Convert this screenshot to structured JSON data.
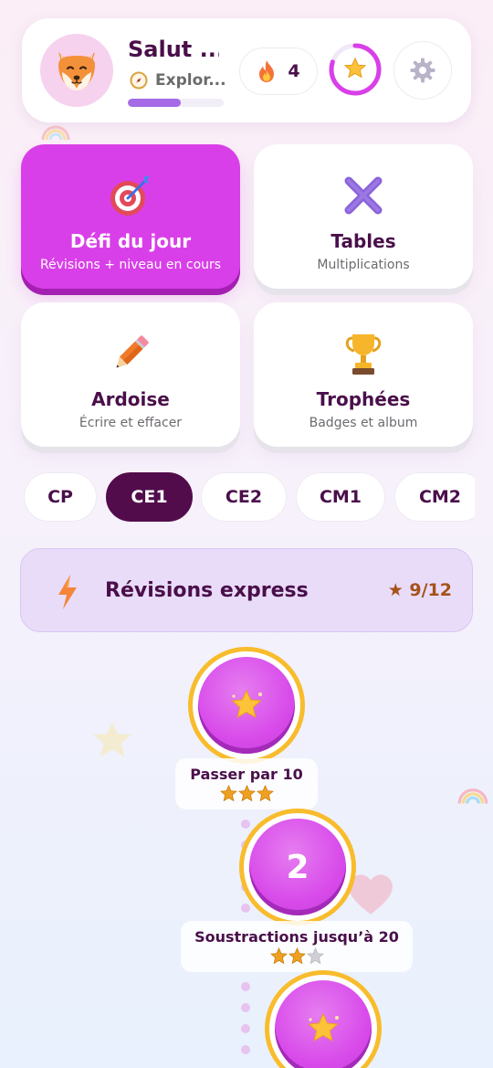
{
  "header": {
    "greeting": "Salut ...",
    "rank": "Explor...",
    "xp_progress": 0.55,
    "streak_count": "4",
    "star_progress": 0.8
  },
  "tiles": [
    {
      "title": "Défi du jour",
      "subtitle": "Révisions + niveau en cours",
      "icon": "target-icon"
    },
    {
      "title": "Tables",
      "subtitle": "Multiplications",
      "icon": "multiply-icon"
    },
    {
      "title": "Ardoise",
      "subtitle": "Écrire et effacer",
      "icon": "pencil-icon"
    },
    {
      "title": "Trophées",
      "subtitle": "Badges et album",
      "icon": "trophy-icon"
    }
  ],
  "grades": {
    "items": [
      "CP",
      "CE1",
      "CE2",
      "CM1",
      "CM2"
    ],
    "selected": "CE1"
  },
  "section": {
    "title": "Révisions express",
    "score": "★ 9/12"
  },
  "lessons": [
    {
      "badge": "star",
      "label": "Passer par 10",
      "stars": 3
    },
    {
      "badge": "2",
      "label": "Soustractions jusqu’à 20",
      "stars": 2
    },
    {
      "badge": "star",
      "label": "",
      "stars": 0
    }
  ],
  "colors": {
    "accent": "#d93fe8",
    "dark": "#520c4b",
    "gold": "#f8bc2c",
    "banner": "#e9dcf9"
  }
}
